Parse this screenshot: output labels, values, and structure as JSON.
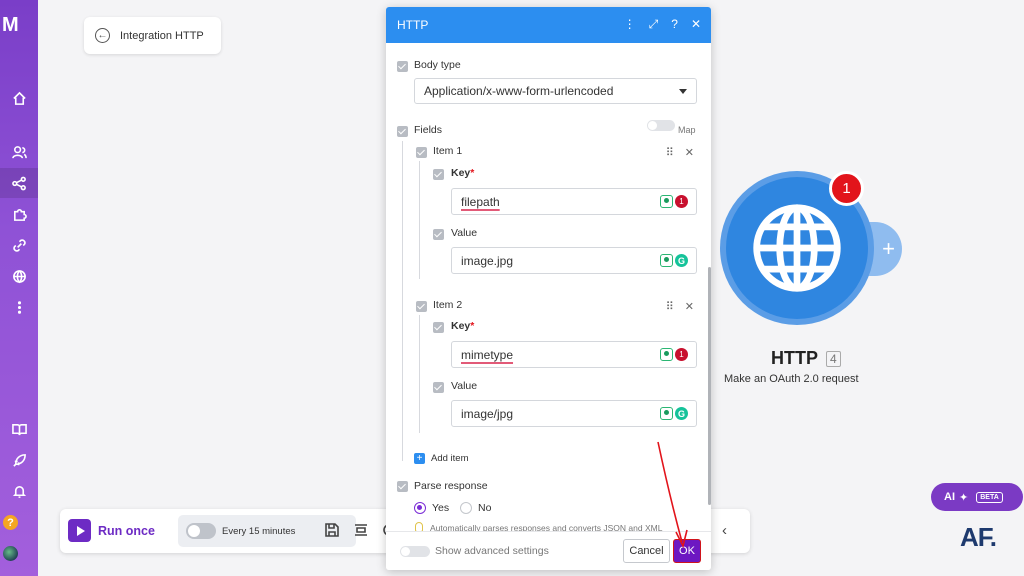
{
  "colors": {
    "sidebar": "#8f52d6",
    "accent": "#2c8ef0",
    "primary_button": "#6d17c2",
    "module": "#2f86e0",
    "badge": "#e2141b"
  },
  "sidebar": {
    "logo": "M",
    "icons": [
      "home-icon",
      "team-icon",
      "scenarios-icon",
      "apps-icon",
      "connections-icon",
      "webhooks-icon",
      "more-icon",
      "docs-icon",
      "rocket-icon",
      "bell-icon",
      "help-icon",
      "avatar"
    ]
  },
  "scenario": {
    "title": "Integration HTTP"
  },
  "toolbar": {
    "run_label": "Run once",
    "schedule_label": "Every 15 minutes"
  },
  "module": {
    "title": "HTTP",
    "number": "4",
    "subtitle": "Make an OAuth 2.0 request",
    "badge": "1"
  },
  "ai_button": {
    "label": "AI",
    "beta": "BETA"
  },
  "brand_logo": "AF.",
  "dialog": {
    "title": "HTTP",
    "body_type": {
      "label": "Body type",
      "value": "Application/x-www-form-urlencoded"
    },
    "fields": {
      "label": "Fields",
      "map_label": "Map",
      "items": [
        {
          "label": "Item 1",
          "key_label": "Key",
          "key_value": "filepath",
          "value_label": "Value",
          "value_value": "image.jpg",
          "key_badge": "1"
        },
        {
          "label": "Item 2",
          "key_label": "Key",
          "key_value": "mimetype",
          "value_label": "Value",
          "value_value": "image/jpg",
          "key_badge": "1"
        }
      ],
      "add_item": "Add item"
    },
    "parse_response": {
      "label": "Parse response",
      "yes": "Yes",
      "no": "No",
      "selected": "Yes",
      "hint": "Automatically parses responses and converts JSON and XML"
    },
    "footer": {
      "advanced": "Show advanced settings",
      "cancel": "Cancel",
      "ok": "OK"
    }
  }
}
